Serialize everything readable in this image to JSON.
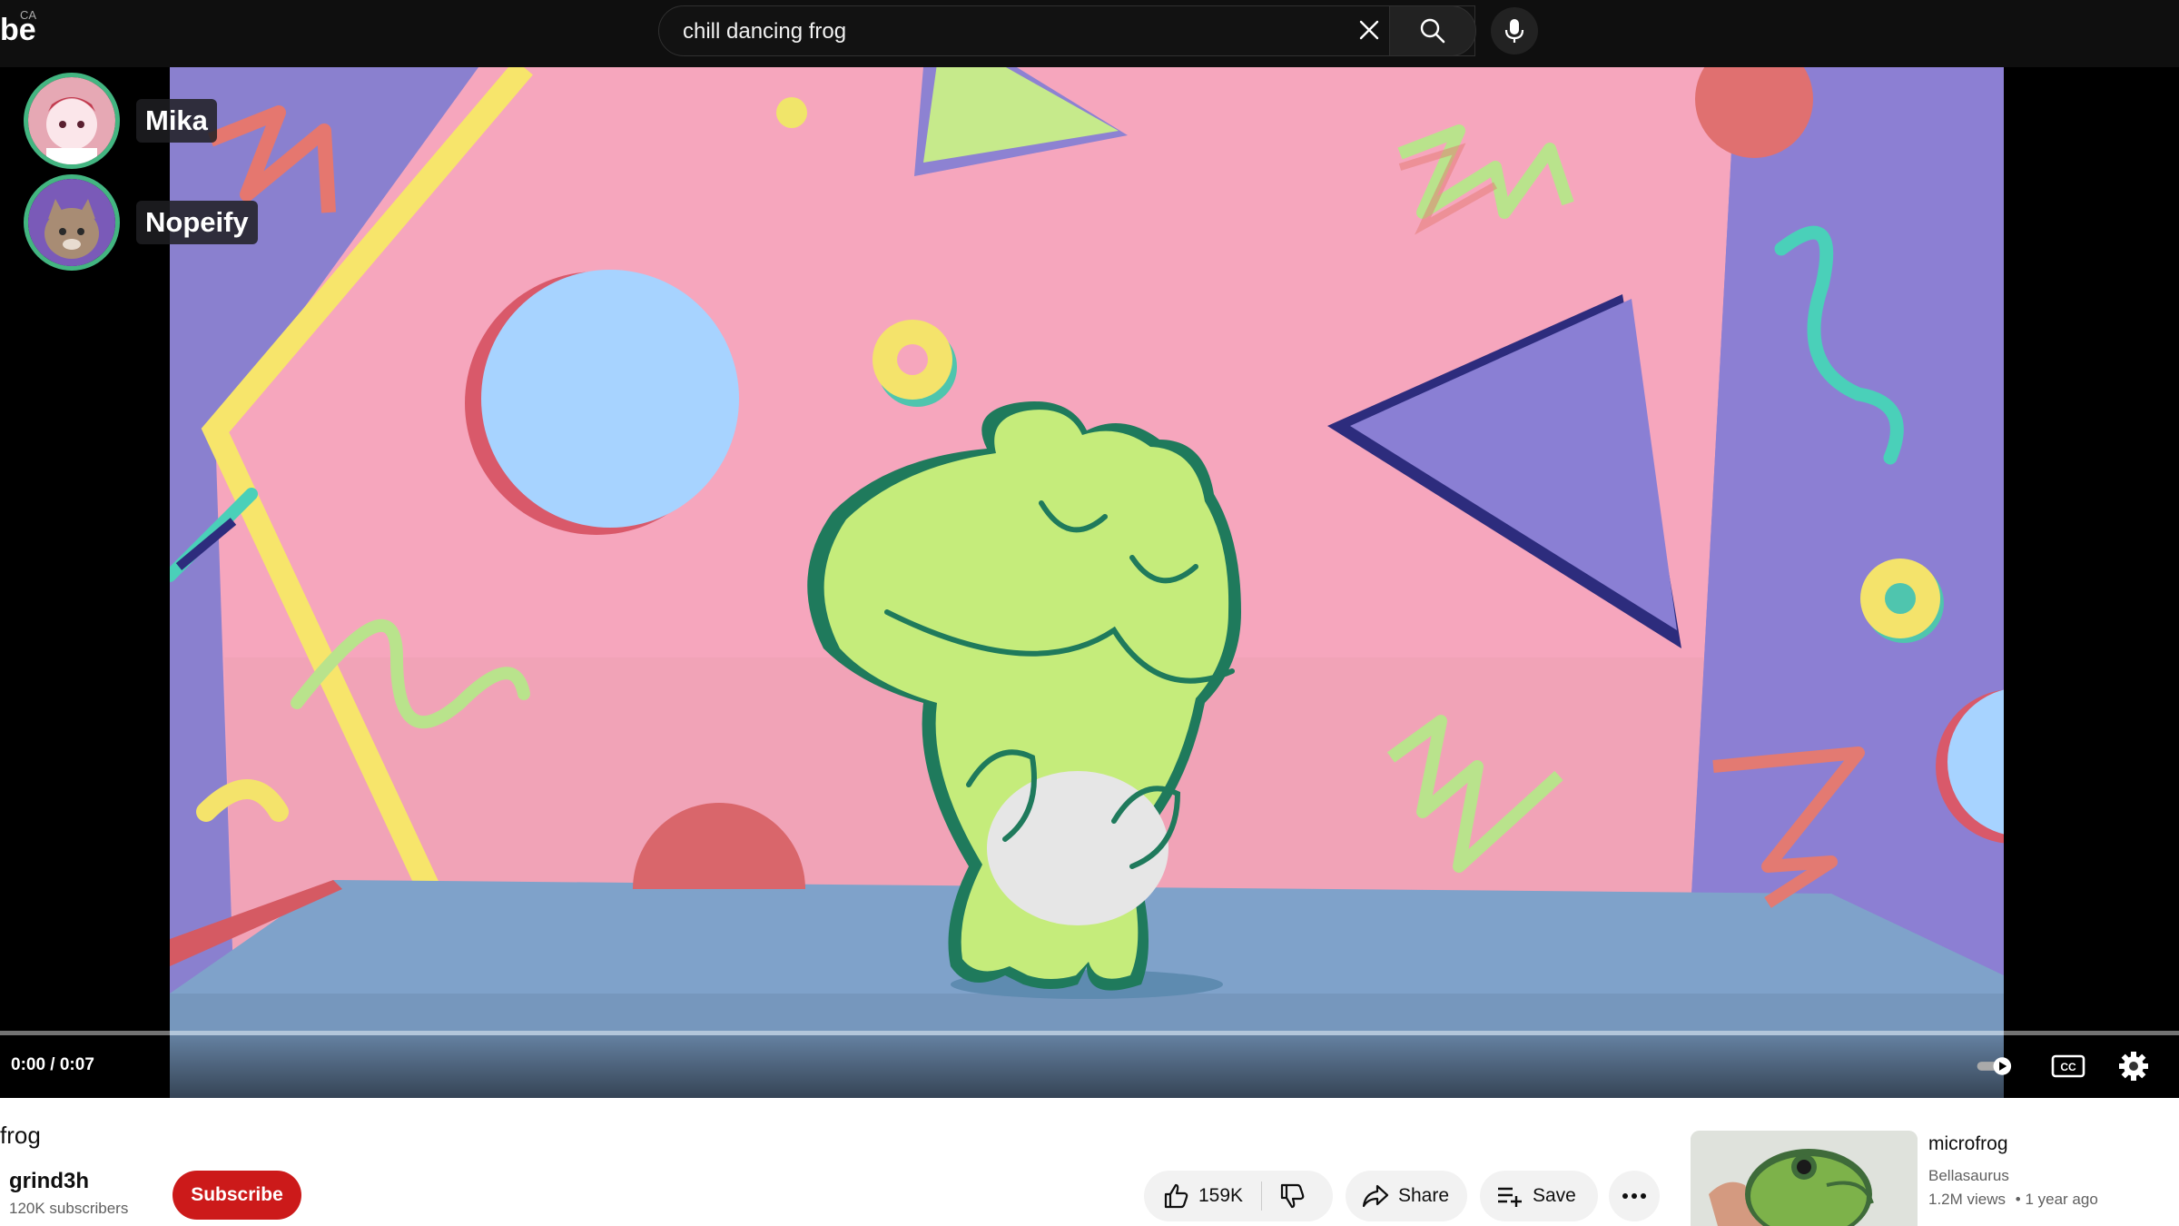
{
  "topbar": {
    "logo_fragment": "be",
    "country_code": "CA",
    "search_value": "chill dancing frog"
  },
  "voice_call": {
    "users": [
      {
        "name": "Mika"
      },
      {
        "name": "Nopeify"
      }
    ]
  },
  "player": {
    "time": "0:00 / 0:07",
    "progress": 0.0,
    "autoplay": "on",
    "captions_label": "CC"
  },
  "info": {
    "title_fragment": "frog",
    "channel_name": "grind3h",
    "subscribers": "120K subscribers",
    "subscribe_label": "Subscribe",
    "like_count": "159K",
    "share_label": "Share",
    "save_label": "Save"
  },
  "recommendation": {
    "title": "microfrog",
    "channel": "Bellasaurus",
    "views": "1.2M views",
    "age": "• 1 year ago"
  },
  "colors": {
    "subscribe": "#cc1a1a",
    "voice_ring": "#43b581",
    "frog": "#c5ec7b"
  }
}
